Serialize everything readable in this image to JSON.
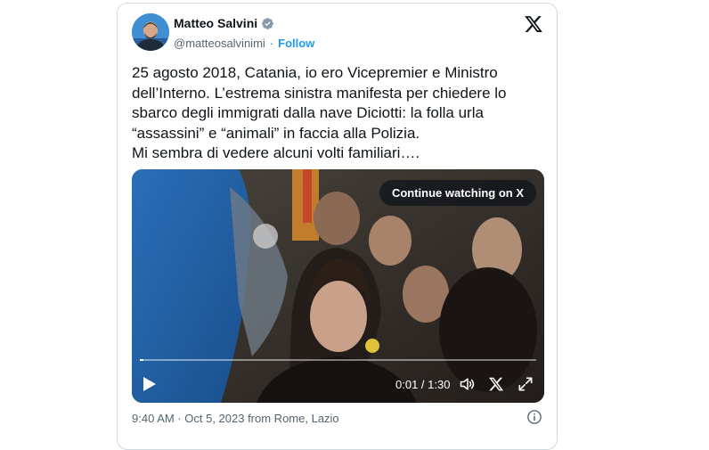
{
  "author": {
    "name": "Matteo Salvini",
    "handle": "@matteosalvinimi",
    "separator": "·",
    "follow_label": "Follow"
  },
  "tweet": {
    "lines": [
      "25 agosto 2018, Catania, io ero Vicepremier e Ministro",
      "dell’Interno. L’estrema sinistra manifesta per chiedere lo",
      "sbarco degli immigrati dalla nave Diciotti: la folla urla",
      "“assassini” e “animali” in faccia alla Polizia.",
      "Mi sembra di vedere alcuni volti familiari…."
    ]
  },
  "video": {
    "continue_label": "Continue watching on X",
    "time": "0:01 / 1:30",
    "progress_fraction": 0.01
  },
  "footer": {
    "meta": "9:40 AM · Oct 5, 2023 from Rome, Lazio"
  },
  "icons": {
    "verified": "verified-badge-icon",
    "x_logo": "x-logo-icon",
    "play": "play-icon",
    "volume": "volume-icon",
    "x_video": "x-logo-icon",
    "fullscreen": "fullscreen-icon",
    "info": "info-icon"
  },
  "colors": {
    "accent": "#1d9bf0",
    "text": "#0f1419",
    "muted": "#536471",
    "border": "#cfd9de"
  }
}
